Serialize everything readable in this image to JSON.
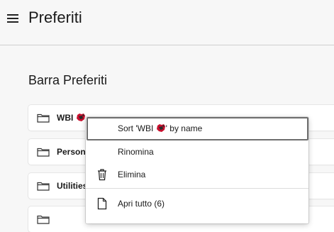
{
  "header": {
    "title": "Preferiti",
    "menu_icon": "hamburger-icon"
  },
  "section": {
    "title": "Barra Preferiti"
  },
  "folders": [
    {
      "label": "WBI",
      "badge": true,
      "icon": "folder-icon"
    },
    {
      "label": "Persona",
      "badge": false,
      "icon": "folder-icon"
    },
    {
      "label": "Utilities",
      "badge": false,
      "icon": "folder-icon"
    },
    {
      "label": "",
      "badge": false,
      "icon": "folder-icon"
    }
  ],
  "context_menu": {
    "sort": {
      "prefix": "Sort 'WBI ",
      "suffix": "' by name"
    },
    "rename": "Rinomina",
    "delete": {
      "label": "Elimina",
      "icon": "trash-icon"
    },
    "open_all": {
      "label": "Apri tutto (6)",
      "icon": "page-icon"
    }
  },
  "colors": {
    "background": "#f7f7f7",
    "card": "#ffffff",
    "badge_red": "#c8102e",
    "badge_dark": "#2b2b2b"
  }
}
